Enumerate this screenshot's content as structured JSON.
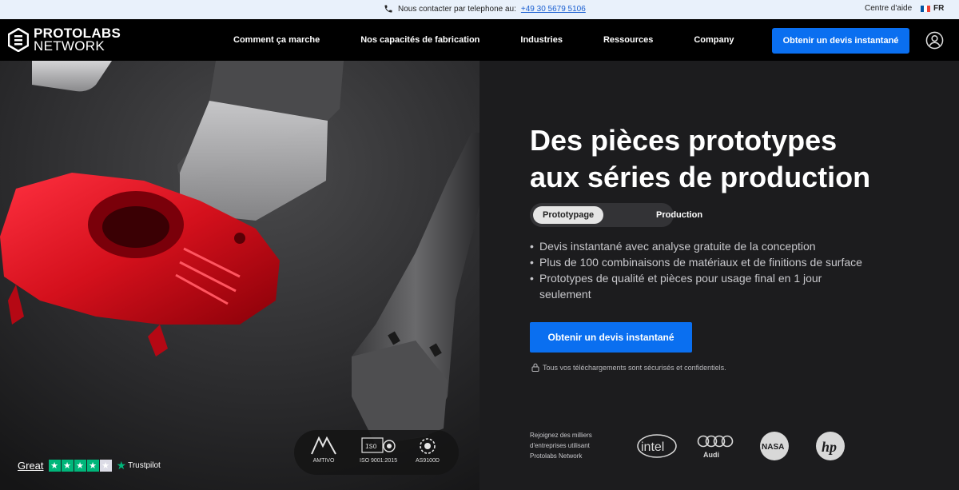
{
  "topbar": {
    "contact_label": "Nous contacter par telephone au:",
    "phone": "+49 30 5679 5106",
    "help": "Centre d'aide",
    "lang": "FR"
  },
  "nav": {
    "logo_line1": "PROTOLABS",
    "logo_line2": "NETWORK",
    "links": [
      "Comment ça marche",
      "Nos capacités de fabrication",
      "Industries",
      "Ressources",
      "Company"
    ],
    "cta": "Obtenir un devis instantané"
  },
  "hero": {
    "headline_line1": "Des pièces prototypes",
    "headline_line2": "aux séries de production",
    "toggle": [
      "Prototypage",
      "Production"
    ],
    "features": [
      "Devis instantané avec analyse gratuite de la conception",
      "Plus de 100 combinaisons de matériaux et de finitions de surface",
      "Prototypes de qualité et pièces pour usage final en 1 jour seulement"
    ],
    "cta": "Obtenir un devis instantané",
    "secure_note": "Tous vos téléchargements sont sécurisés et confidentiels.",
    "join_text": "Rejoignez des milliers d'entreprises utilisant Protolabs Network"
  },
  "brands": [
    "intel",
    "Audi",
    "NASA",
    "hp"
  ],
  "certifications": [
    {
      "label": "AMTIVO"
    },
    {
      "badge": "ISO",
      "label": "ISO 9001:2015"
    },
    {
      "label": "AS9100D"
    }
  ],
  "trustpilot": {
    "rating_text": "Great",
    "brand": "Trustpilot",
    "stars": 4
  },
  "colors": {
    "accent": "#0a6ff0",
    "trust_green": "#00b67a"
  }
}
